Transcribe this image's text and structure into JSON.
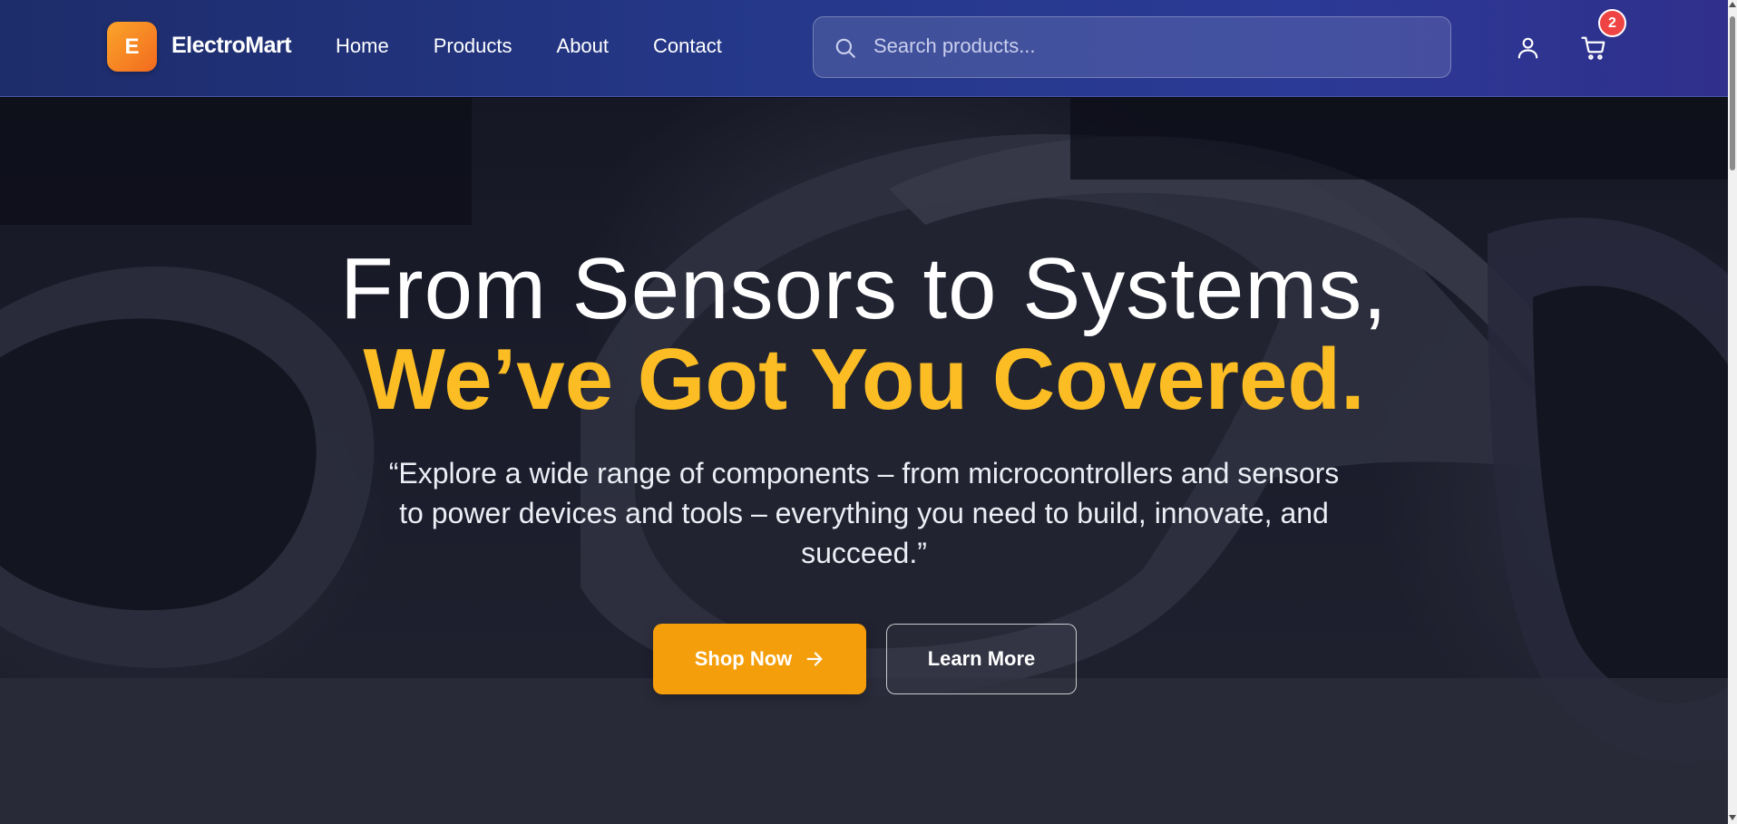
{
  "brand": {
    "logo_letter": "E",
    "name": "ElectroMart"
  },
  "nav": {
    "items": [
      {
        "label": "Home"
      },
      {
        "label": "Products"
      },
      {
        "label": "About"
      },
      {
        "label": "Contact"
      }
    ]
  },
  "search": {
    "placeholder": "Search products...",
    "value": ""
  },
  "header_icons": {
    "account": "user-icon",
    "cart": "cart-icon",
    "cart_count": "2"
  },
  "hero": {
    "title_line1": "From Sensors to Systems,",
    "title_line2": "We’ve Got You Covered.",
    "subtitle": "“Explore a wide range of components – from microcontrollers and sensors to power devices and tools – everything you need to build, innovate, and succeed.”",
    "primary_button": "Shop Now",
    "secondary_button": "Learn More"
  },
  "colors": {
    "header_start": "#1d2c6a",
    "header_end": "#302f8c",
    "accent": "#f59e0b",
    "headline_accent": "#fbbd23",
    "badge": "#ef4444"
  }
}
